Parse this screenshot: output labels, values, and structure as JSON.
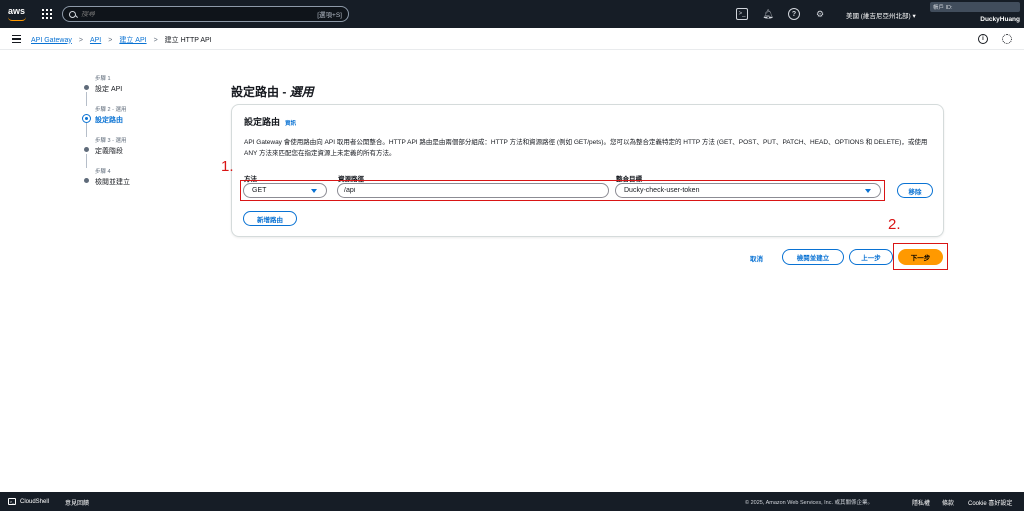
{
  "topnav": {
    "logo": "aws",
    "search_placeholder": "搜尋",
    "search_shortcut": "[選項+S]",
    "region": "美國 (維吉尼亞州北部) ▾",
    "account_label": "帳戶 ID:",
    "account_name": "DuckyHuang"
  },
  "breadcrumb": {
    "items": [
      "API Gateway",
      "API",
      "建立 API"
    ],
    "current": "建立 HTTP API"
  },
  "steps": [
    {
      "label": "步驟 1",
      "title": "設定 API"
    },
    {
      "label": "步驟 2 - 選用",
      "title": "設定路由"
    },
    {
      "label": "步驟 3 - 選用",
      "title": "定義階段"
    },
    {
      "label": "步驟 4",
      "title": "檢閱並建立"
    }
  ],
  "page": {
    "title_main": "設定路由 - ",
    "title_em": "選用"
  },
  "card": {
    "title": "設定路由",
    "info": "資訊",
    "description": "API Gateway 會使用路由向 API 取用者公開整合。HTTP API 路由是由兩個部分組成：HTTP 方法和資源路徑 (例如 GET/pets)。您可以為整合定義特定的 HTTP 方法 (GET、POST、PUT、PATCH、HEAD、OPTIONS 和 DELETE)，或使用 ANY 方法來匹配您在指定資源上未定義的所有方法。",
    "method_label": "方法",
    "path_label": "資源路徑",
    "target_label": "整合目標",
    "method_value": "GET",
    "path_value": "/api",
    "target_value": "Ducky-check-user-token",
    "remove_label": "移除",
    "add_route_label": "新增路由"
  },
  "annotations": {
    "one": "1.",
    "two": "2."
  },
  "actions": {
    "cancel": "取消",
    "review": "檢閱並建立",
    "prev": "上一步",
    "next": "下一步"
  },
  "footer": {
    "cloudshell": "CloudShell",
    "feedback": "意見回饋",
    "copyright": "© 2025, Amazon Web Services, Inc. 或其關係企業。",
    "privacy": "隱私權",
    "terms": "條款",
    "cookie": "Cookie 喜好設定"
  },
  "colors": {
    "accent": "#0972d3",
    "primary": "#ff9900",
    "annotation": "#d91515",
    "nav": "#161d26"
  }
}
